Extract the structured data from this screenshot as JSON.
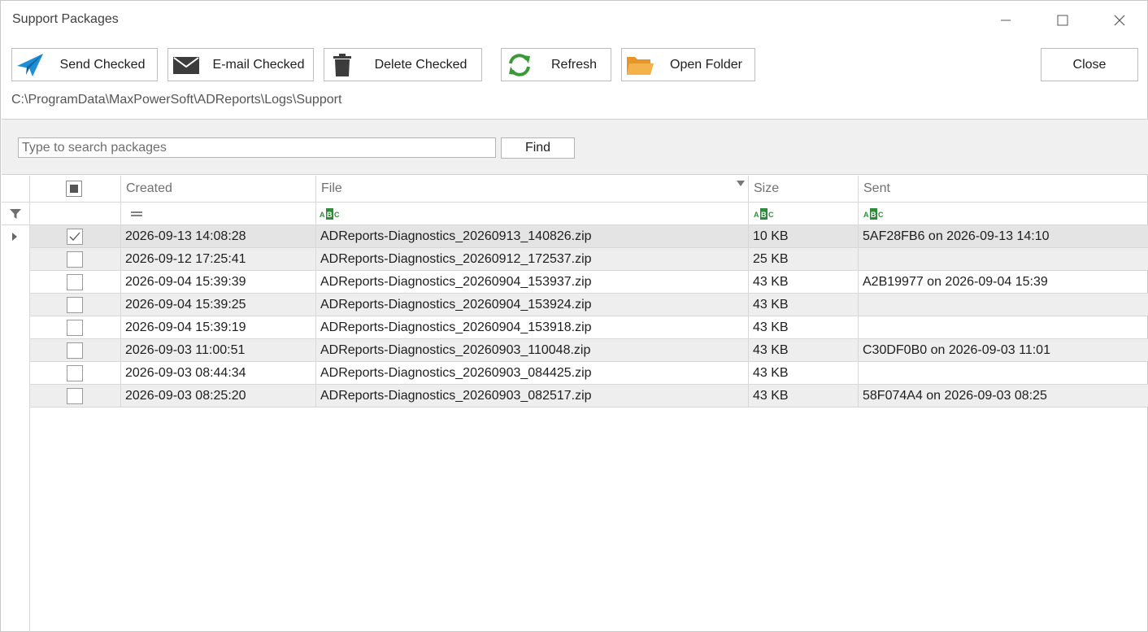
{
  "window": {
    "title": "Support Packages"
  },
  "toolbar": {
    "send_label": "Send Checked",
    "email_label": "E-mail Checked",
    "delete_label": "Delete Checked",
    "refresh_label": "Refresh",
    "open_folder_label": "Open Folder",
    "close_label": "Close"
  },
  "path": "C:\\ProgramData\\MaxPowerSoft\\ADReports\\Logs\\Support",
  "search": {
    "placeholder": "Type to search packages",
    "value": "",
    "find_label": "Find"
  },
  "grid": {
    "columns": [
      "Created",
      "File",
      "Size",
      "Sent"
    ],
    "rows": [
      {
        "checked": true,
        "created": "2026-09-13 14:08:28",
        "file": "ADReports-Diagnostics_20260913_140826.zip",
        "size": "10 KB",
        "sent": "5AF28FB6 on 2026-09-13 14:10"
      },
      {
        "checked": false,
        "created": "2026-09-12 17:25:41",
        "file": "ADReports-Diagnostics_20260912_172537.zip",
        "size": "25 KB",
        "sent": ""
      },
      {
        "checked": false,
        "created": "2026-09-04 15:39:39",
        "file": "ADReports-Diagnostics_20260904_153937.zip",
        "size": "43 KB",
        "sent": "A2B19977 on 2026-09-04 15:39"
      },
      {
        "checked": false,
        "created": "2026-09-04 15:39:25",
        "file": "ADReports-Diagnostics_20260904_153924.zip",
        "size": "43 KB",
        "sent": ""
      },
      {
        "checked": false,
        "created": "2026-09-04 15:39:19",
        "file": "ADReports-Diagnostics_20260904_153918.zip",
        "size": "43 KB",
        "sent": ""
      },
      {
        "checked": false,
        "created": "2026-09-03 11:00:51",
        "file": "ADReports-Diagnostics_20260903_110048.zip",
        "size": "43 KB",
        "sent": "C30DF0B0 on 2026-09-03 11:01"
      },
      {
        "checked": false,
        "created": "2026-09-03 08:44:34",
        "file": "ADReports-Diagnostics_20260903_084425.zip",
        "size": "43 KB",
        "sent": ""
      },
      {
        "checked": false,
        "created": "2026-09-03 08:25:20",
        "file": "ADReports-Diagnostics_20260903_082517.zip",
        "size": "43 KB",
        "sent": "58F074A4 on 2026-09-03 08:25"
      }
    ]
  },
  "colors": {
    "send_icon": "#1e8fd6",
    "refresh_icon": "#3a9a3a",
    "folder_icon": "#f0a030",
    "dark_icon": "#3c3c3c",
    "abc_icon": "#2e8b3a"
  }
}
